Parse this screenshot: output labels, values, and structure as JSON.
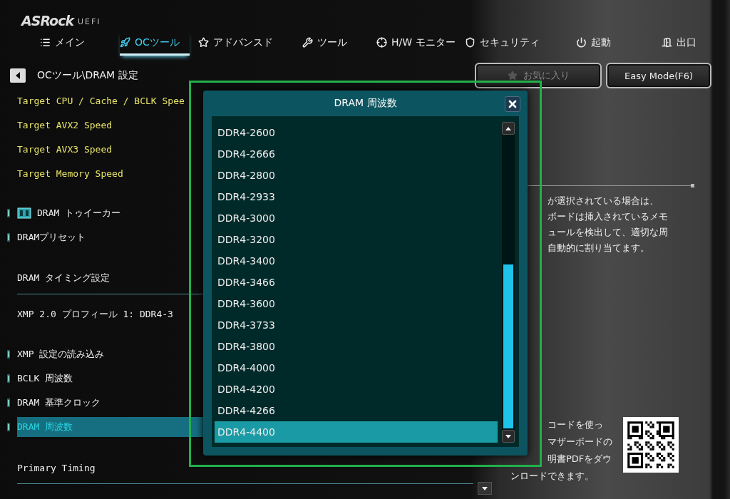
{
  "logo": {
    "brand": "ASRock",
    "suffix": "UEFI"
  },
  "tabs": [
    {
      "label": "メイン",
      "selected": false
    },
    {
      "label": "OCツール",
      "selected": true
    },
    {
      "label": "アドバンスド",
      "selected": false
    },
    {
      "label": "ツール",
      "selected": false
    },
    {
      "label": "H/W モニター",
      "selected": false
    },
    {
      "label": "セキュリティ",
      "selected": false
    },
    {
      "label": "起動",
      "selected": false
    },
    {
      "label": "出口",
      "selected": false
    }
  ],
  "breadcrumb": {
    "path": "OCツール\\DRAM 設定"
  },
  "buttons": [
    {
      "label": "お気に入り",
      "kind": "favorite",
      "disabled": true
    },
    {
      "label": "Easy Mode(F6)",
      "kind": "plain",
      "disabled": false
    }
  ],
  "settings": [
    {
      "items": [
        {
          "label": "Target CPU / Cache / BCLK Spee",
          "kind": "target"
        },
        {
          "label": "Target AVX2 Speed",
          "kind": "target"
        },
        {
          "label": "Target AVX3 Speed",
          "kind": "target"
        },
        {
          "label": "Target Memory Speed",
          "kind": "target"
        }
      ]
    },
    {
      "items": [
        {
          "label": "DRAM トゥイーカー",
          "kind": "tool",
          "selected": false
        },
        {
          "label": "DRAMプリセット",
          "kind": "option",
          "selected": false
        }
      ]
    },
    {
      "items": [
        {
          "label": "DRAM タイミング設定",
          "kind": "heading"
        },
        {
          "label": "XMP 2.0 プロフィール 1: DDR4-3",
          "kind": "value"
        }
      ]
    },
    {
      "items": [
        {
          "label": "XMP 設定の読み込み",
          "kind": "option",
          "selected": false
        },
        {
          "label": "BCLK 周波数",
          "kind": "option",
          "selected": false
        },
        {
          "label": "DRAM 基準クロック",
          "kind": "option",
          "selected": false
        },
        {
          "label": "DRAM 周波数",
          "kind": "option",
          "selected": true
        }
      ]
    },
    {
      "items": [
        {
          "label": "Primary Timing",
          "kind": "heading"
        }
      ]
    }
  ],
  "help": {
    "lines": [
      "が選択されている場合は、",
      "ボードは挿入されているメモ",
      "ュールを検出して、適切な周",
      "自動的に割り当てます。"
    ]
  },
  "download": {
    "lines": [
      "コードを使っ",
      "マザーボードの",
      "明書PDFをダウ",
      "ンロードできます。"
    ]
  },
  "dialog": {
    "title": "DRAM 周波数",
    "options": [
      {
        "label": "DDR4-2600",
        "selected": false
      },
      {
        "label": "DDR4-2666",
        "selected": false
      },
      {
        "label": "DDR4-2800",
        "selected": false
      },
      {
        "label": "DDR4-2933",
        "selected": false
      },
      {
        "label": "DDR4-3000",
        "selected": false
      },
      {
        "label": "DDR4-3200",
        "selected": false
      },
      {
        "label": "DDR4-3400",
        "selected": false
      },
      {
        "label": "DDR4-3466",
        "selected": false
      },
      {
        "label": "DDR4-3600",
        "selected": false
      },
      {
        "label": "DDR4-3733",
        "selected": false
      },
      {
        "label": "DDR4-3800",
        "selected": false
      },
      {
        "label": "DDR4-4000",
        "selected": false
      },
      {
        "label": "DDR4-4200",
        "selected": false
      },
      {
        "label": "DDR4-4266",
        "selected": false
      },
      {
        "label": "DDR4-4400",
        "selected": true
      }
    ]
  }
}
